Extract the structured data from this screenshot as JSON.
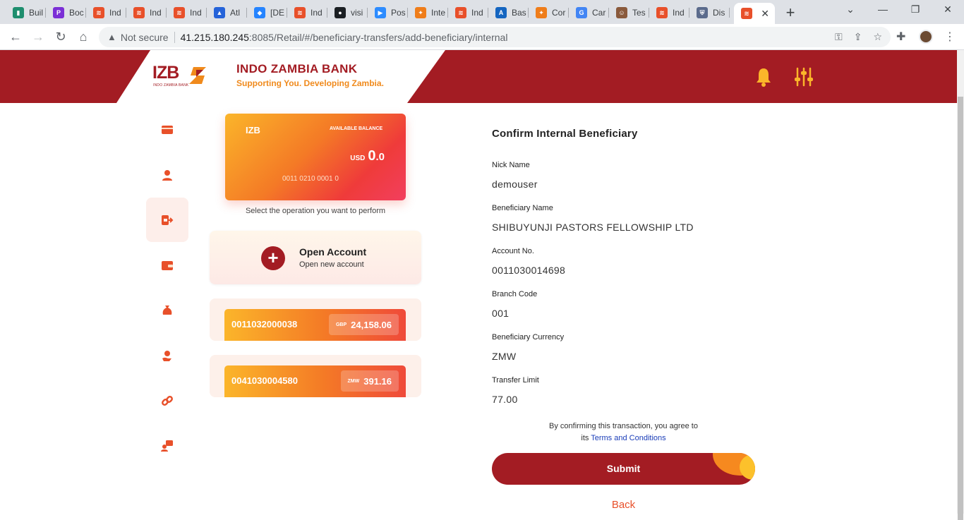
{
  "browser": {
    "tabs": [
      {
        "label": "Buil",
        "icon": "builder-favicon-icon",
        "color": "#1e8e6e"
      },
      {
        "label": "Boc",
        "icon": "p-favicon-icon",
        "color": "#7b2fd6"
      },
      {
        "label": "Ind",
        "icon": "izb-favicon-icon",
        "color": "#e8502a"
      },
      {
        "label": "Ind",
        "icon": "izb-favicon-icon",
        "color": "#e8502a"
      },
      {
        "label": "Ind",
        "icon": "izb-favicon-icon",
        "color": "#e8502a"
      },
      {
        "label": "Atl",
        "icon": "atlassian-favicon-icon",
        "color": "#2563d9"
      },
      {
        "label": "[DE",
        "icon": "jira-favicon-icon",
        "color": "#2684ff"
      },
      {
        "label": "Ind",
        "icon": "izb-favicon-icon",
        "color": "#e8502a"
      },
      {
        "label": "visi",
        "icon": "github-favicon-icon",
        "color": "#1b1f23"
      },
      {
        "label": "Pos",
        "icon": "zoom-favicon-icon",
        "color": "#2d8cff"
      },
      {
        "label": "Inte",
        "icon": "postman-favicon-icon",
        "color": "#ef7d1a"
      },
      {
        "label": "Ind",
        "icon": "izb-favicon-icon",
        "color": "#e8502a"
      },
      {
        "label": "Bas",
        "icon": "azure-favicon-icon",
        "color": "#1565c0"
      },
      {
        "label": "Cor",
        "icon": "postman-favicon-icon",
        "color": "#ef7d1a"
      },
      {
        "label": "Car",
        "icon": "google-favicon-icon",
        "color": "#4285f4"
      },
      {
        "label": "Tes",
        "icon": "avatar-favicon-icon",
        "color": "#8a5a3c"
      },
      {
        "label": "Ind",
        "icon": "izb-favicon-icon",
        "color": "#e8502a"
      },
      {
        "label": "Dis",
        "icon": "shield-favicon-icon",
        "color": "#5b6b8c"
      },
      {
        "label": "",
        "icon": "izb-favicon-icon",
        "color": "#e8502a",
        "active": true
      }
    ],
    "new_tab": "+",
    "window_controls": {
      "menu": "⌄",
      "minimize": "—",
      "restore": "❐",
      "close": "✕"
    },
    "address": {
      "security": "Not secure",
      "host": "41.215.180.245",
      "path": ":8085/Retail/#/beneficiary-transfers/add-beneficiary/internal"
    }
  },
  "header": {
    "logo_text": "IZB",
    "logo_subtext": "INDO ZAMBIA BANK",
    "bank_name": "INDO ZAMBIA BANK",
    "tagline": "Supporting You. Developing Zambia."
  },
  "sidebar": {
    "items": [
      {
        "name": "accounts",
        "icon": "card-icon"
      },
      {
        "name": "profile",
        "icon": "user-icon"
      },
      {
        "name": "transfers",
        "icon": "transfer-icon",
        "active": true
      },
      {
        "name": "wallet",
        "icon": "wallet-icon"
      },
      {
        "name": "loans",
        "icon": "money-bag-icon"
      },
      {
        "name": "beneficiaries",
        "icon": "user-hand-icon"
      },
      {
        "name": "links",
        "icon": "link-icon"
      },
      {
        "name": "support",
        "icon": "chat-user-icon"
      }
    ]
  },
  "balance_card": {
    "brand": "IZB",
    "label": "AVAILABLE BALANCE",
    "currency": "USD",
    "amount_int": "0",
    "amount_dec": ".0",
    "account_number": "0011 0210 0001 0"
  },
  "operation_hint": "Select the operation you want to perform",
  "open_account": {
    "title": "Open Account",
    "subtitle": "Open new account"
  },
  "accounts": [
    {
      "number": "0011032000038",
      "currency": "GBP",
      "balance": "24,158.06"
    },
    {
      "number": "0041030004580",
      "currency": "ZMW",
      "balance": "391.16"
    }
  ],
  "form": {
    "title": "Confirm Internal Beneficiary",
    "fields": [
      {
        "label": "Nick Name",
        "value": "demouser"
      },
      {
        "label": "Beneficiary Name",
        "value": "SHIBUYUNJI PASTORS FELLOWSHIP LTD"
      },
      {
        "label": "Account No.",
        "value": "0011030014698"
      },
      {
        "label": "Branch Code",
        "value": "001"
      },
      {
        "label": "Beneficiary Currency",
        "value": "ZMW"
      },
      {
        "label": "Transfer Limit",
        "value": "77.00"
      }
    ],
    "agreement_text": "By confirming this transaction, you agree to",
    "agreement_prefix": "its",
    "terms_link": "Terms and Conditions",
    "submit_label": "Submit",
    "back_label": "Back"
  },
  "colors": {
    "brand_red": "#a31c23",
    "accent_orange": "#e8502a",
    "tagline_orange": "#f08a1c",
    "link_blue": "#1a3db8"
  }
}
